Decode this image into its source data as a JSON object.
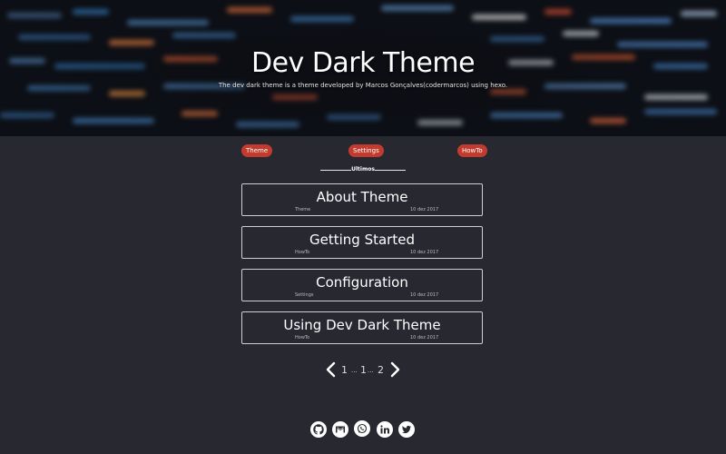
{
  "header": {
    "title": "Dev Dark Theme",
    "subtitle": "The dev dark theme is a theme developed by Marcos Gonçalves(codermarcos) using hexo."
  },
  "nav": {
    "items": [
      {
        "label": "Theme"
      },
      {
        "label": "Settings"
      },
      {
        "label": "HowTo"
      }
    ]
  },
  "section": {
    "heading": "Ultimos"
  },
  "posts": [
    {
      "title": "About Theme",
      "category": "Theme",
      "date": "10 dez 2017"
    },
    {
      "title": "Getting Started",
      "category": "HowTo",
      "date": "10 dez 2017"
    },
    {
      "title": "Configuration",
      "category": "Settings",
      "date": "10 dez 2017"
    },
    {
      "title": "Using Dev Dark Theme",
      "category": "HowTo",
      "date": "10 dez 2017"
    }
  ],
  "pagination": {
    "prev_icon": "chevron-left-icon",
    "pages": [
      "1",
      "...",
      "1",
      "...",
      "2"
    ],
    "next_icon": "chevron-right-icon"
  },
  "social": [
    "github-icon",
    "gmail-icon",
    "whatsapp-icon",
    "linkedin-icon",
    "twitter-icon"
  ],
  "colors": {
    "background": "#272830",
    "accent": "#c23b2e",
    "border": "#cfcfcf"
  }
}
